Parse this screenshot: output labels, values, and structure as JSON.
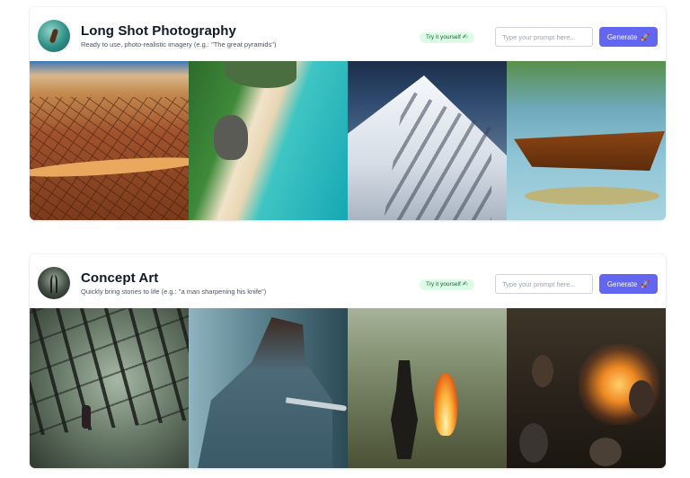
{
  "sections": [
    {
      "title": "Long Shot Photography",
      "subtitle": "Ready to use, photo-realistic imagery (e.g.: \"The great pyramids\")",
      "badge": "Try it yourself",
      "badge_icon": "✍",
      "prompt_placeholder": "Type your prompt here...",
      "prompt_value": "",
      "generate_label": "Generate",
      "generate_icon": "rocket-icon"
    },
    {
      "title": "Concept Art",
      "subtitle": "Quickly bring stories to life (e.g.: \"a man sharpening his knife\")",
      "badge": "Try it yourself",
      "badge_icon": "✍",
      "prompt_placeholder": "Type your prompt here...",
      "prompt_value": "",
      "generate_label": "Generate",
      "generate_icon": "rocket-icon"
    }
  ],
  "colors": {
    "accent": "#6366f1",
    "badge_bg": "#dcfce7",
    "badge_text": "#166534",
    "title_text": "#111827",
    "subtitle_text": "#4b5563"
  }
}
